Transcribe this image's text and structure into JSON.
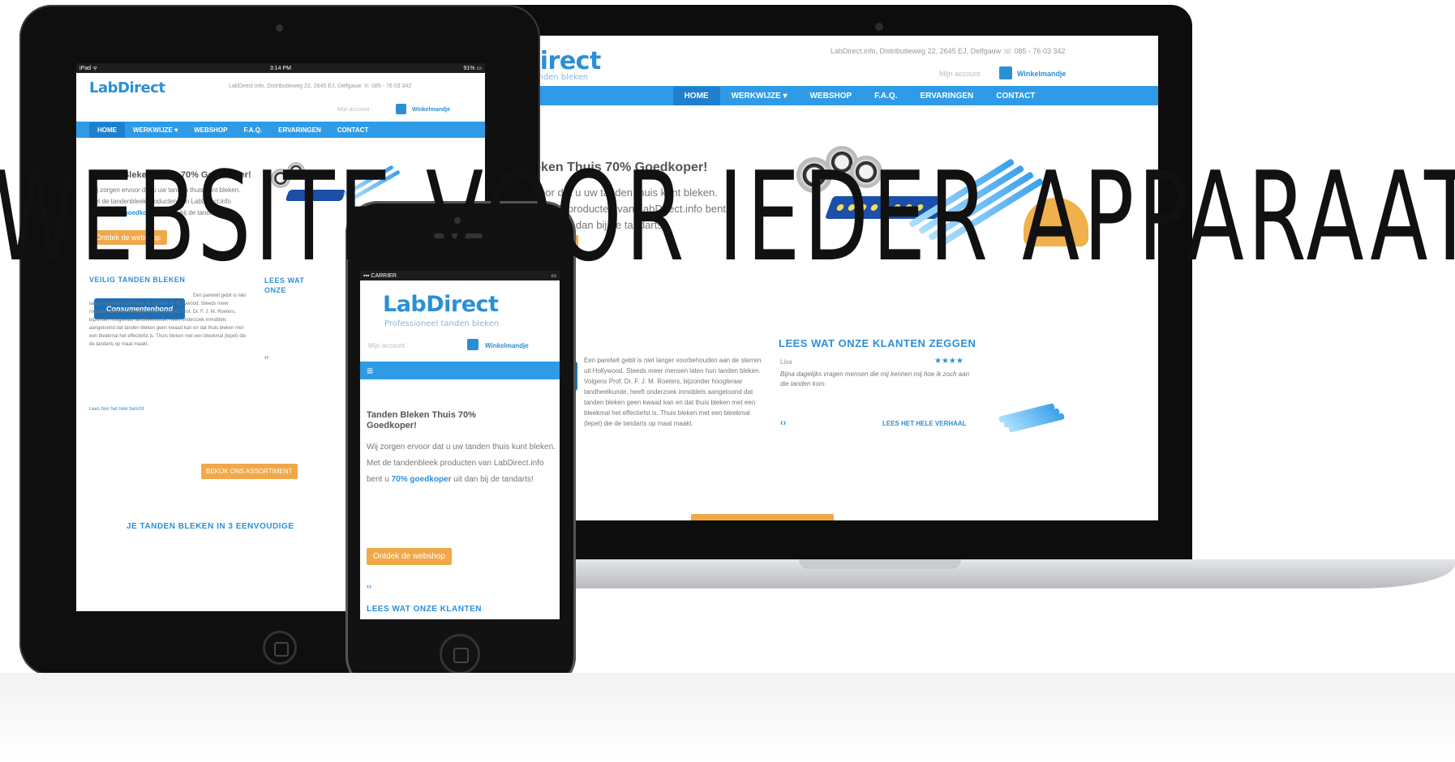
{
  "overlay_title": "WEBSITE VOOR IEDER APPARAAT",
  "site": {
    "logo": "LabDirect",
    "tagline": "Professioneel tanden bleken",
    "contact": "LabDirect.info, Distributieweg 22, 2645 EJ, Delfgauw ☏ 085 - 76 03 342",
    "ipad_contact": "LabDirect.info, Distributieweg 22, 2645 EJ, Delfgauw ☏ 085 - 76 03 342",
    "account": "Mijn account",
    "cart": "Winkelmandje",
    "nav": [
      "HOME",
      "WERKWIJZE ▾",
      "WEBSHOP",
      "F.A.Q.",
      "ERVARINGEN",
      "CONTACT"
    ],
    "hero_title": "Tanden Bleken Thuis 70% Goedkoper!",
    "hero_text_1": "Wij zorgen ervoor dat u uw tanden thuis kunt bleken. Met de tandenbleek producten van LabDirect.info bent u ",
    "hero_highlight": "70% goedkoper",
    "hero_text_2": " uit dan bij de tandarts!",
    "webshop_button": "Ontdek de webshop",
    "safe_title": "VEILIG TANDEN BLEKEN",
    "safe_badge": "Consumentenbond",
    "safe_text": "Een parelwit gebit is niet langer voorbehouden aan de sterren uit Hollywood. Steeds meer mensen laten hun tanden bleken. Volgens Prof. Dr. F. J. M. Roeters, bijzonder hoogleraar tandheelkunde, heeft onderzoek inmiddels aangetoond dat tanden bleken geen kwaad kan en dat thuis bleken met een bleekmal het effectiefst is. Thuis bleken met een bleekmal (lepel) die de tandarts op maat maakt.",
    "read_more": "Lees hier het hele bericht",
    "reviews_title": "LEES WAT ONZE KLANTEN ZEGGEN",
    "review_name": "Lisa",
    "review_stars": "★★★★",
    "review_text": "Bijna dagelijks vragen mensen die mij kennen mij hoe ik zoch aan die tanden kom.",
    "review_more": "LEES HET HELE VERHAAL",
    "arrows": "‹›",
    "assortment_button": "BEKIJK ONS ASSORTIMENT",
    "steps_title": "JE TANDEN BLEKEN IN 3 EENVOUDIGE",
    "phone_reviews_title": "LEES WAT ONZE KLANTEN",
    "phone_hero_title": "Tanden Bleken Thuis 70% Goedkoper!"
  },
  "ipad_status": {
    "left": "iPad ᯤ",
    "time": "3:14 PM",
    "battery": "91% ▭"
  },
  "iphone_status": {
    "left": "▪▪▪ CARRIER",
    "battery": "▭"
  },
  "colors": {
    "brand_blue": "#2f9be6",
    "accent_orange": "#f0a84a",
    "title_black": "#111111"
  }
}
